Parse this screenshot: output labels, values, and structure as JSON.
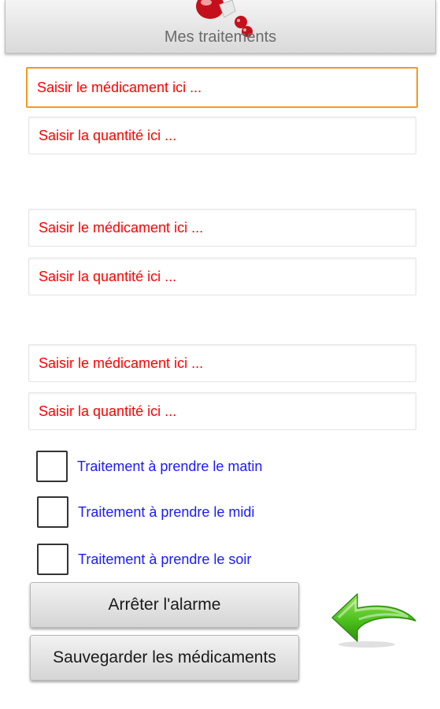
{
  "header": {
    "title": "Mes traitements"
  },
  "form": {
    "groups": [
      {
        "medicament_placeholder": "Saisir le médicament ici ...",
        "quantite_placeholder": "Saisir la quantité ici ..."
      },
      {
        "medicament_placeholder": "Saisir le médicament ici ...",
        "quantite_placeholder": "Saisir la quantité ici ..."
      },
      {
        "medicament_placeholder": "Saisir le médicament ici ...",
        "quantite_placeholder": "Saisir la quantité ici ..."
      }
    ]
  },
  "checkboxes": [
    {
      "label": "Traitement à prendre le matin",
      "checked": false
    },
    {
      "label": "Traitement à prendre le midi",
      "checked": false
    },
    {
      "label": "Traitement à prendre le soir",
      "checked": false
    }
  ],
  "buttons": {
    "stop_alarm": "Arrêter l'alarme",
    "save": "Sauvegarder les médicaments"
  },
  "icons": {
    "header": "pills-icon",
    "back": "back-arrow-icon"
  },
  "colors": {
    "placeholder_text": "#ff0000",
    "checkbox_label": "#1a1aff",
    "focus_border": "#f39b23",
    "arrow": "#4cc21d"
  }
}
